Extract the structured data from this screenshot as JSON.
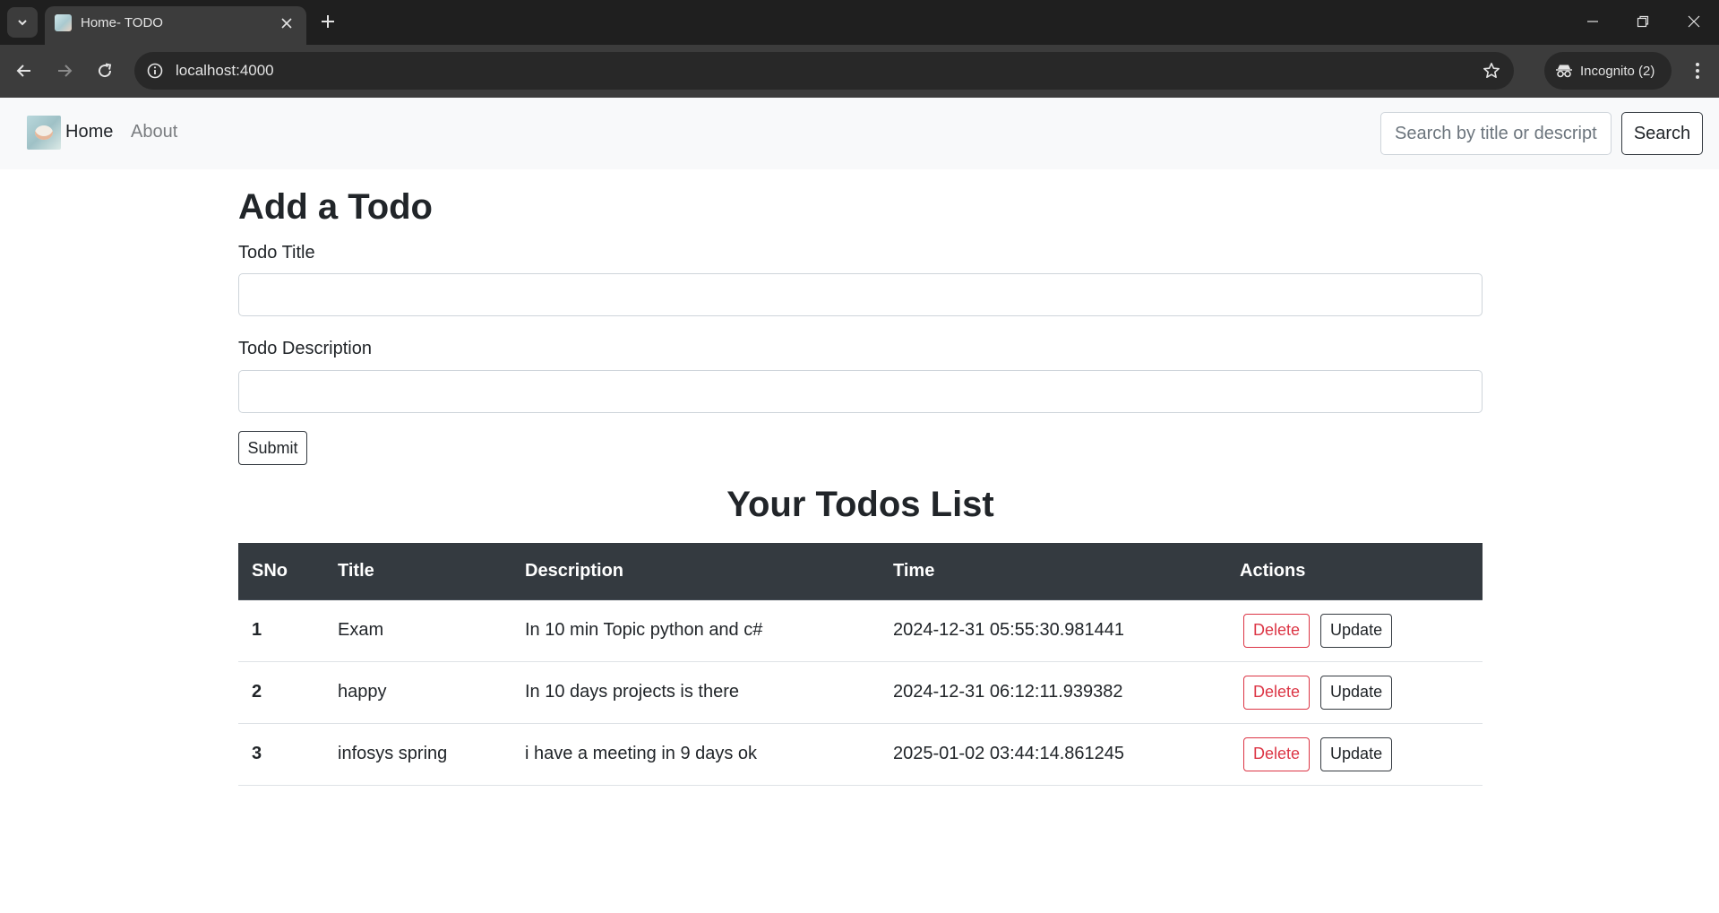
{
  "browser": {
    "tab_title": "Home- TODO",
    "url": "localhost:4000",
    "incognito_label": "Incognito (2)",
    "icons": {
      "tab_search": "chevron-down-icon",
      "new_tab": "plus-icon",
      "back": "arrow-left-icon",
      "forward": "arrow-right-icon",
      "reload": "reload-icon",
      "site_info": "info-icon",
      "bookmark": "star-icon",
      "incognito": "incognito-icon",
      "menu": "more-vertical-icon"
    }
  },
  "navbar": {
    "brand_label": "Home",
    "about_label": "About",
    "search_placeholder": "Search by title or description",
    "search_button": "Search"
  },
  "form": {
    "heading": "Add a Todo",
    "title_label": "Todo Title",
    "title_value": "",
    "description_label": "Todo Description",
    "description_value": "",
    "submit_label": "Submit"
  },
  "list": {
    "heading": "Your Todos List",
    "columns": [
      "SNo",
      "Title",
      "Description",
      "Time",
      "Actions"
    ],
    "rows": [
      {
        "sno": "1",
        "title": "Exam",
        "description": "In 10 min Topic python and c#",
        "time": "2024-12-31 05:55:30.981441",
        "delete": "Delete",
        "update": "Update"
      },
      {
        "sno": "2",
        "title": "happy",
        "description": "In 10 days projects is there",
        "time": "2024-12-31 06:12:11.939382",
        "delete": "Delete",
        "update": "Update"
      },
      {
        "sno": "3",
        "title": "infosys spring",
        "description": "i have a meeting in 9 days ok",
        "time": "2025-01-02 03:44:14.861245",
        "delete": "Delete",
        "update": "Update"
      }
    ]
  },
  "colors": {
    "chrome_dark": "#1f1f1f",
    "chrome_toolbar": "#3c3c3c",
    "navbar_bg": "#f8f9fa",
    "table_header_bg": "#343a40",
    "danger": "#dc3545",
    "text": "#212529"
  }
}
